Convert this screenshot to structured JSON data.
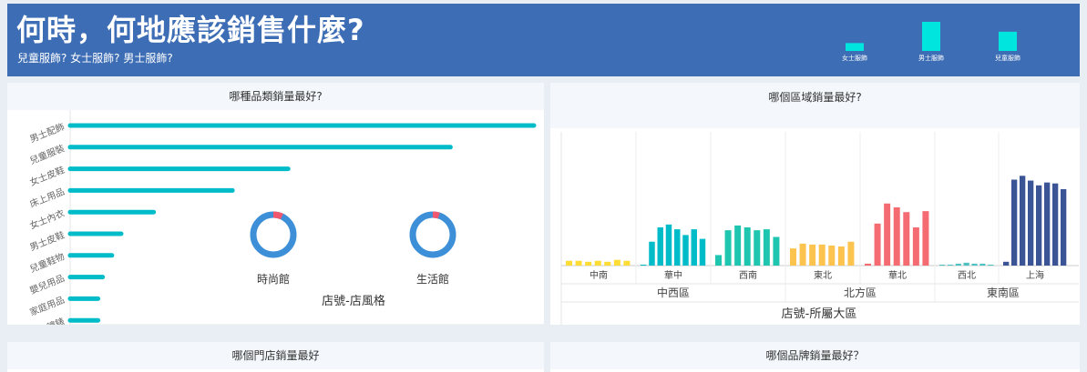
{
  "header": {
    "title": "何時，何地應該銷售什麼?",
    "subtitle": "兒童服飾? 女士服飾? 男士服飾?",
    "legend": [
      {
        "label": "女士服飾",
        "level": 0.27
      },
      {
        "label": "男士服飾",
        "level": 1.0
      },
      {
        "label": "兒童服飾",
        "level": 0.66
      }
    ],
    "legend_color": "#00e5de"
  },
  "panels": {
    "category": {
      "title": "哪種品類銷量最好?"
    },
    "region": {
      "title": "哪個區域銷量最好?"
    },
    "store": {
      "title": "哪個門店銷量最好"
    },
    "brand": {
      "title": "哪個品牌銷量最好？"
    }
  },
  "chart_data": [
    {
      "type": "bar",
      "orientation": "horizontal",
      "categories": [
        "男士配飾",
        "兒童服裝",
        "女士皮鞋",
        "床上用品",
        "女士內衣",
        "男士皮鞋",
        "兒童鞋物",
        "嬰兒用品",
        "家庭用品",
        "鐘錶"
      ],
      "values": [
        100,
        82,
        47,
        35,
        18,
        11,
        9,
        7,
        6,
        6
      ],
      "xlim": [
        0,
        100
      ],
      "color": "#00bcc8"
    },
    {
      "type": "pie",
      "xlabel": "店號-店風格",
      "categories": [
        "時尚館",
        "生活館"
      ],
      "values": [
        0.07,
        0.05
      ],
      "colors": {
        "main": "#3d8fd8",
        "accent": "#f05870"
      }
    },
    {
      "type": "bar",
      "xlabel": "店號-所屬大區",
      "groups": [
        {
          "name": "中西區",
          "subgroups": [
            {
              "name": "中南",
              "color": "#fddc35",
              "values": [
                5,
                5,
                4,
                5,
                4,
                6,
                5
              ]
            },
            {
              "name": "華中",
              "color": "#00bcc8",
              "values": [
                1,
                25,
                40,
                43,
                38,
                32,
                38,
                28
              ]
            },
            {
              "name": "西南",
              "color": "#1ec6b0",
              "values": [
                11,
                37,
                42,
                40,
                37,
                38,
                30
              ]
            }
          ]
        },
        {
          "name": "北方區",
          "subgroups": [
            {
              "name": "東北",
              "color": "#fcc44e",
              "values": [
                18,
                23,
                22,
                22,
                21,
                20,
                25
              ]
            },
            {
              "name": "華北",
              "color": "#f56b72",
              "values": [
                2,
                44,
                65,
                61,
                56,
                40,
                57
              ]
            }
          ]
        },
        {
          "name": "東南區",
          "subgroups": [
            {
              "name": "西北",
              "color": "#4ec2c2",
              "values": [
                1,
                1,
                2,
                3,
                2,
                2,
                1
              ]
            },
            {
              "name": "上海",
              "color": "#3a5495",
              "values": [
                4,
                90,
                94,
                89,
                84,
                87,
                86,
                80
              ]
            }
          ]
        }
      ],
      "ylim": [
        0,
        100
      ]
    }
  ]
}
